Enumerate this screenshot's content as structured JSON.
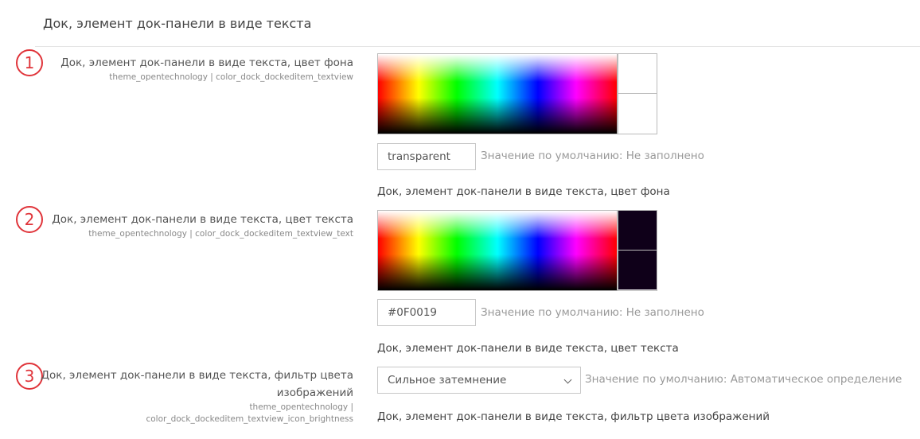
{
  "section": {
    "title": "Док, элемент док-панели в виде текста"
  },
  "colors": {
    "marker": "#e0343a"
  },
  "settings": [
    {
      "marker": "1",
      "label": "Док, элемент док-панели в виде текста, цвет фона",
      "key": "theme_opentechnology | color_dock_dockeditem_textview",
      "value": "transparent",
      "swatch_top": "#ffffff",
      "swatch_bottom": "#ffffff",
      "default_text": "Значение по умолчанию: Не заполнено",
      "description": "Док, элемент док-панели в виде текста, цвет фона"
    },
    {
      "marker": "2",
      "label": "Док, элемент док-панели в виде текста, цвет текста",
      "key": "theme_opentechnology | color_dock_dockeditem_textview_text",
      "value": "#0F0019",
      "swatch_top": "#0F0019",
      "swatch_bottom": "#0F0019",
      "default_text": "Значение по умолчанию: Не заполнено",
      "description": "Док, элемент док-панели в виде текста, цвет текста"
    },
    {
      "marker": "3",
      "label": "Док, элемент док-панели в виде текста, фильтр цвета изображений",
      "key": "theme_opentechnology | color_dock_dockeditem_textview_icon_brightness",
      "selected": "Сильное затемнение",
      "default_text": "Значение по умолчанию: Автоматическое определение",
      "description": "Док, элемент док-панели в виде текста, фильтр цвета изображений"
    }
  ]
}
